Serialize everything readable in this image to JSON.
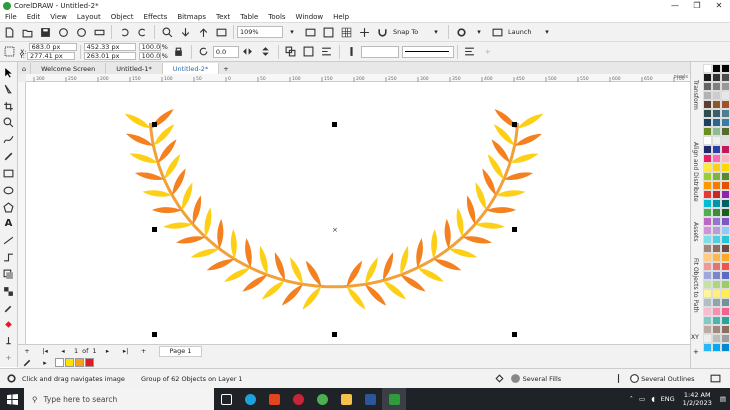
{
  "window": {
    "title": "CorelDRAW - Untitled-2*",
    "minimize": "—",
    "maximize": "❐",
    "close": "✕"
  },
  "menu": [
    "File",
    "Edit",
    "View",
    "Layout",
    "Object",
    "Effects",
    "Bitmaps",
    "Text",
    "Table",
    "Tools",
    "Window",
    "Help"
  ],
  "toolbar": {
    "zoom": "109%",
    "snap": "Snap To",
    "launch": "Launch"
  },
  "props": {
    "x_label": "X:",
    "x": "683.0 px",
    "y_label": "Y:",
    "y": "277.41 px",
    "w": "452.33 px",
    "h": "263.01 px",
    "sx": "100.0",
    "sy": "100.0",
    "pct": "%",
    "rotate": "0.0"
  },
  "tabs": [
    "Welcome Screen",
    "Untitled-1*",
    "Untitled-2*"
  ],
  "ruler_units": "pixels",
  "ruler_ticks": [
    "300",
    "250",
    "200",
    "150",
    "100",
    "50",
    "0",
    "50",
    "100",
    "150",
    "200",
    "250",
    "300",
    "350",
    "400",
    "450",
    "500",
    "550",
    "600",
    "650",
    "700"
  ],
  "page_nav": {
    "current": "1",
    "of": "of",
    "total": "1",
    "page_tab": "Page 1"
  },
  "dockers": [
    "Transform",
    "Align and Distribute",
    "Assets",
    "Fit Objects to Path"
  ],
  "xy_label": "XY",
  "status": {
    "hint": "Click and drag navigates image",
    "selection": "Group of 62 Objects on Layer 1",
    "fill": "Several Fills",
    "outline": "Several Outlines"
  },
  "taskbar": {
    "search_placeholder": "Type here to search",
    "lang": "ENG",
    "time": "1:42 AM",
    "date": "1/2/2023"
  },
  "colors": {
    "leaf_light": "#fdd017",
    "leaf_dark": "#f4801f",
    "stem": "#f2a03a",
    "accent": "#2a6ab0"
  },
  "document_swatches": [
    "#ffffff",
    "#fde300",
    "#f7a21b",
    "#e01b24"
  ],
  "palette": [
    "#ffffff",
    "#000000",
    "#000000",
    "#1a1a1a",
    "#333333",
    "#4d4d4d",
    "#666666",
    "#808080",
    "#999999",
    "#b3b3b3",
    "#cccccc",
    "#e6e6e6",
    "#5c4033",
    "#8b5a2b",
    "#a0522d",
    "#2f4f4f",
    "#3b5e6b",
    "#4f7f8f",
    "#1c3f5e",
    "#2f6690",
    "#3a7ca5",
    "#6b8e23",
    "#8fbc8f",
    "#556b2f",
    "#ffffff",
    "#f0f0f0",
    "#e0e0e0",
    "#1f2a6b",
    "#2e3fa8",
    "#c2185b",
    "#e91e63",
    "#ff69b4",
    "#ffb6c1",
    "#ffeb3b",
    "#fdd017",
    "#ffd700",
    "#9acd32",
    "#7cb342",
    "#558b2f",
    "#ff9800",
    "#f57c00",
    "#e65100",
    "#e53935",
    "#c62828",
    "#8e24aa",
    "#00bcd4",
    "#0097a7",
    "#006064",
    "#4caf50",
    "#388e3c",
    "#1b5e20",
    "#ba68c8",
    "#9575cd",
    "#7e57c2",
    "#ce93d8",
    "#b39ddb",
    "#90caf9",
    "#80deea",
    "#4dd0e1",
    "#26c6da",
    "#a1887f",
    "#8d6e63",
    "#6d4c41",
    "#ffcc80",
    "#ffb74d",
    "#ffa726",
    "#ef9a9a",
    "#e57373",
    "#ef5350",
    "#9fa8da",
    "#7986cb",
    "#5c6bc0",
    "#c5e1a5",
    "#aed581",
    "#9ccc65",
    "#fff59d",
    "#fff176",
    "#ffee58",
    "#b0bec5",
    "#90a4ae",
    "#78909c",
    "#f8bbd0",
    "#f48fb1",
    "#f06292",
    "#80cbc4",
    "#4db6ac",
    "#26a69a",
    "#bcaaa4",
    "#a1887f",
    "#8d6e63",
    "#eeeeee",
    "#bdbdbd",
    "#9e9e9e",
    "#29b6f6",
    "#03a9f4",
    "#0288d1"
  ]
}
